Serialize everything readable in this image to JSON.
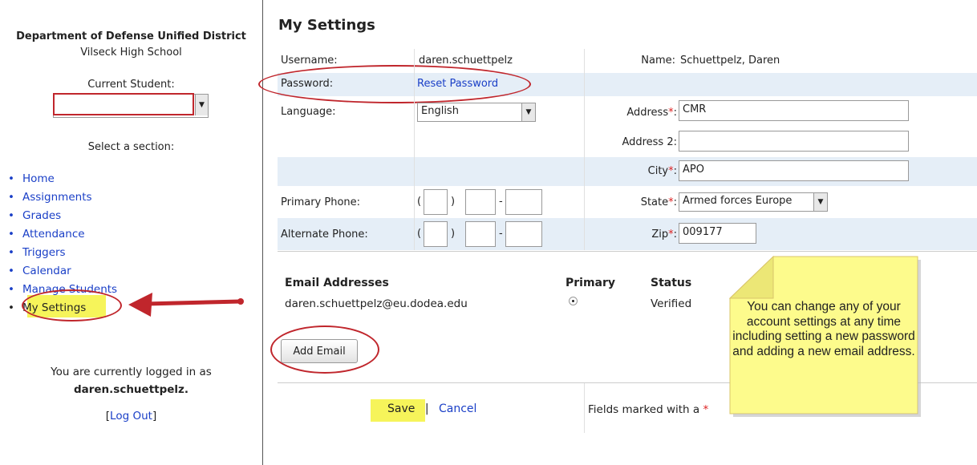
{
  "sidebar": {
    "district": "Department of Defense Unified District",
    "school": "Vilseck High School",
    "current_student_label": "Current Student:",
    "current_student_value": "",
    "select_section_label": "Select a section:",
    "nav": [
      "Home",
      "Assignments",
      "Grades",
      "Attendance",
      "Triggers",
      "Calendar",
      "Manage Students",
      "My Settings"
    ],
    "logged_in_text": "You are currently logged in as",
    "logged_in_user": "daren.schuettpelz.",
    "logout_open": "[",
    "logout_label": "Log Out",
    "logout_close": "]"
  },
  "page_title": "My Settings",
  "form": {
    "username_label": "Username:",
    "username_value": "daren.schuettpelz",
    "name_label": "Name:",
    "name_value": "Schuettpelz, Daren",
    "password_label": "Password:",
    "reset_password": "Reset Password",
    "language_label": "Language:",
    "language_value": "English",
    "address_label": "Address",
    "address_value": "CMR",
    "address2_label": "Address 2:",
    "address2_value": "",
    "city_label": "City",
    "city_value": "APO",
    "primary_phone_label": "Primary Phone:",
    "alternate_phone_label": "Alternate Phone:",
    "state_label": "State",
    "state_value": "Armed forces Europe",
    "zip_label": "Zip",
    "zip_value": "009177",
    "required_mark": "*",
    "colon": ":"
  },
  "email": {
    "header_addresses": "Email Addresses",
    "header_primary": "Primary",
    "header_status": "Status",
    "address": "daren.schuettpelz@eu.dodea.edu",
    "status": "Verified",
    "add_button": "Add Email"
  },
  "footer": {
    "save": "Save",
    "separator": "|",
    "cancel": "Cancel",
    "fields_note": "Fields marked with a",
    "asterisk": "*"
  },
  "callout": "You can change any of your account settings at any time including setting a new password and adding a new email address.",
  "colors": {
    "highlight": "#f6f45a",
    "annotation_red": "#c0262c",
    "link": "#1a3fc7",
    "alt_row": "#e5eef7",
    "note": "#fdfb8c"
  }
}
